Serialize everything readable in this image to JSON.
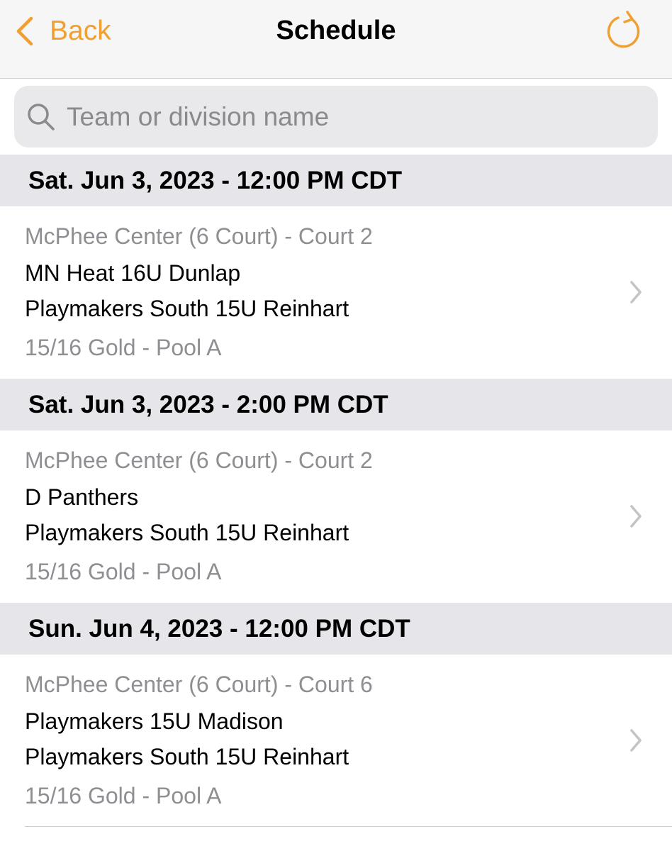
{
  "navbar": {
    "back_label": "Back",
    "title": "Schedule",
    "back_icon": "chevron-left-icon",
    "refresh_icon": "refresh-icon",
    "accent_color": "#f0a030"
  },
  "search": {
    "placeholder": "Team or division name",
    "value": ""
  },
  "sections": [
    {
      "header": "Sat. Jun 3, 2023 - 12:00 PM CDT",
      "venue": "McPhee Center (6 Court) - Court 2",
      "team1": "MN Heat 16U  Dunlap",
      "team2": "Playmakers South 15U Reinhart",
      "division": "15/16 Gold - Pool A"
    },
    {
      "header": "Sat. Jun 3, 2023 - 2:00 PM CDT",
      "venue": "McPhee Center (6 Court) - Court 2",
      "team1": "D Panthers",
      "team2": "Playmakers South 15U Reinhart",
      "division": "15/16 Gold - Pool A"
    },
    {
      "header": "Sun. Jun 4, 2023 - 12:00 PM CDT",
      "venue": "McPhee Center (6 Court) - Court 6",
      "team1": "Playmakers 15U Madison",
      "team2": "Playmakers South 15U Reinhart",
      "division": "15/16 Gold - Pool A"
    }
  ]
}
